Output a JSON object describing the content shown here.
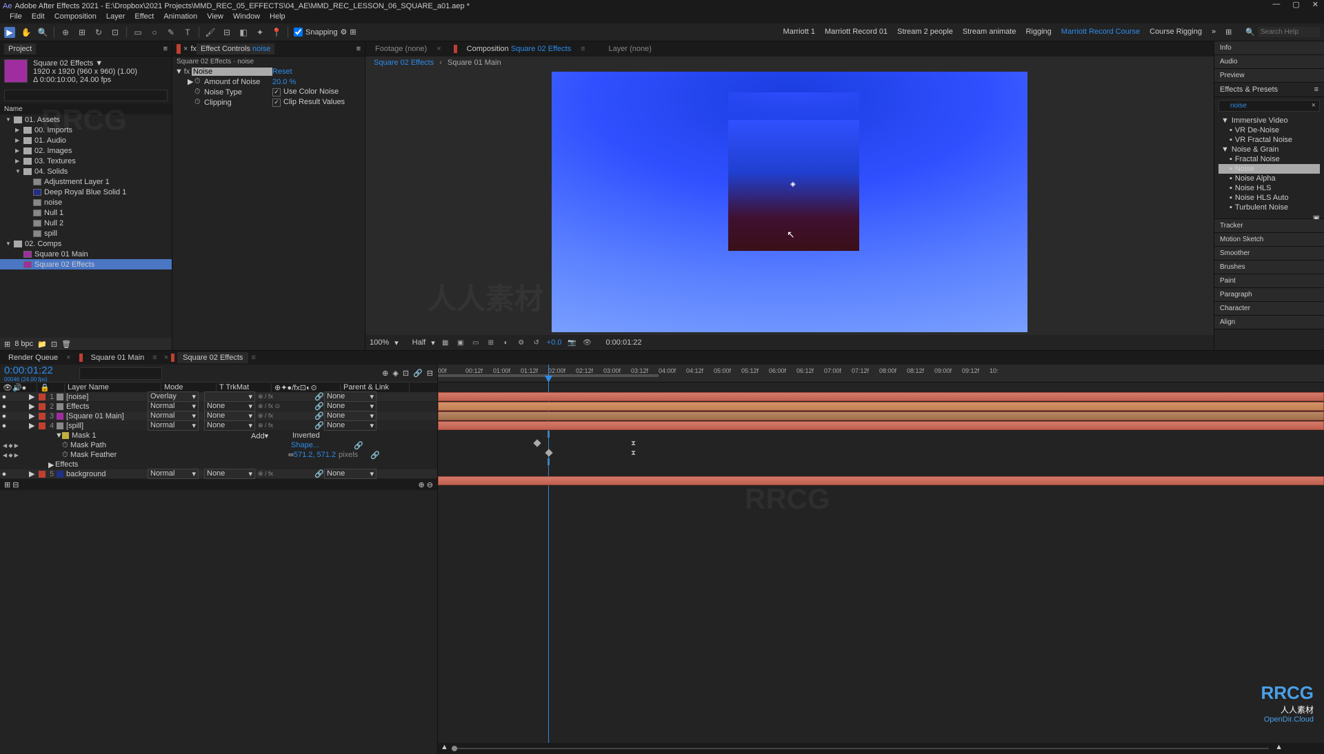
{
  "window": {
    "title": "Adobe After Effects 2021 - E:\\Dropbox\\2021 Projects\\MMD_REC_05_EFFECTS\\04_AE\\MMD_REC_LESSON_06_SQUARE_a01.aep *"
  },
  "menu": [
    "File",
    "Edit",
    "Composition",
    "Layer",
    "Effect",
    "Animation",
    "View",
    "Window",
    "Help"
  ],
  "toolbar": {
    "snapping": "Snapping",
    "workspaces": [
      "Marriott 1",
      "Marriott Record 01",
      "Stream 2 people",
      "Stream animate",
      "Rigging",
      "Marriott Record Course",
      "Course Rigging"
    ],
    "active_workspace": 5,
    "search_placeholder": "Search Help"
  },
  "project": {
    "tab": "Project",
    "sel_name": "Square 02 Effects ▼",
    "sel_dims": "1920 x 1920 (960 x 960) (1.00)",
    "sel_dur": "Δ 0:00:10:00, 24.00 fps",
    "name_hdr": "Name",
    "bpc": "8 bpc",
    "items": [
      {
        "indent": 0,
        "caret": "▼",
        "type": "folder",
        "label": "01. Assets"
      },
      {
        "indent": 1,
        "caret": "▶",
        "type": "folder",
        "label": "00. Imports"
      },
      {
        "indent": 1,
        "caret": "▶",
        "type": "folder",
        "label": "01. Audio"
      },
      {
        "indent": 1,
        "caret": "▶",
        "type": "folder",
        "label": "02. Images"
      },
      {
        "indent": 1,
        "caret": "▶",
        "type": "folder",
        "label": "03. Textures"
      },
      {
        "indent": 1,
        "caret": "▼",
        "type": "folder",
        "label": "04. Solids"
      },
      {
        "indent": 2,
        "type": "solid",
        "color": "#888",
        "label": "Adjustment Layer 1"
      },
      {
        "indent": 2,
        "type": "solid",
        "color": "#203088",
        "label": "Deep Royal Blue Solid 1"
      },
      {
        "indent": 2,
        "type": "solid",
        "color": "#888",
        "label": "noise"
      },
      {
        "indent": 2,
        "type": "solid",
        "color": "#888",
        "label": "Null 1"
      },
      {
        "indent": 2,
        "type": "solid",
        "color": "#888",
        "label": "Null 2"
      },
      {
        "indent": 2,
        "type": "solid",
        "color": "#888",
        "label": "spill"
      },
      {
        "indent": 0,
        "caret": "▼",
        "type": "folder",
        "label": "02. Comps"
      },
      {
        "indent": 1,
        "type": "comp",
        "label": "Square 01 Main"
      },
      {
        "indent": 1,
        "type": "comp",
        "label": "Square 02 Effects",
        "sel": true
      }
    ]
  },
  "effect_controls": {
    "tab": "Effect Controls",
    "layer": "noise",
    "breadcrumb": "Square 02 Effects · noise",
    "effect_name": "Noise",
    "reset": "Reset",
    "props": [
      {
        "stopwatch": true,
        "label": "Amount of Noise",
        "value": "20.0 %"
      },
      {
        "stopwatch": true,
        "label": "Noise Type",
        "checkbox": true,
        "cblabel": "Use Color Noise"
      },
      {
        "stopwatch": true,
        "label": "Clipping",
        "checkbox": true,
        "cblabel": "Clip Result Values"
      }
    ]
  },
  "viewer": {
    "footage_tab": "Footage (none)",
    "comp_tab_prefix": "Composition",
    "comp_tab_name": "Square 02 Effects",
    "layer_tab": "Layer (none)",
    "comp_chain": [
      "Square 02 Effects",
      "Square 01 Main"
    ],
    "zoom": "100%",
    "res": "Half",
    "expo": "+0.0",
    "time": "0:00:01:22"
  },
  "right": {
    "sections": [
      "Info",
      "Audio",
      "Preview",
      "Effects & Presets",
      "Tracker",
      "Motion Sketch",
      "Smoother",
      "Brushes",
      "Paint",
      "Paragraph",
      "Character",
      "Align"
    ],
    "preset_search": "noise",
    "preset_tree": [
      {
        "indent": 0,
        "caret": "▼",
        "label": "Immersive Video"
      },
      {
        "indent": 1,
        "label": "VR De-Noise"
      },
      {
        "indent": 1,
        "label": "VR Fractal Noise"
      },
      {
        "indent": 0,
        "caret": "▼",
        "label": "Noise & Grain"
      },
      {
        "indent": 1,
        "label": "Fractal Noise"
      },
      {
        "indent": 1,
        "label": "Noise",
        "sel": true
      },
      {
        "indent": 1,
        "label": "Noise Alpha"
      },
      {
        "indent": 1,
        "label": "Noise HLS"
      },
      {
        "indent": 1,
        "label": "Noise HLS Auto"
      },
      {
        "indent": 1,
        "label": "Turbulent Noise"
      }
    ]
  },
  "timeline": {
    "tabs": [
      "Render Queue",
      "Square 01 Main",
      "Square 02 Effects"
    ],
    "active_tab": 2,
    "timecode": "0:00:01:22",
    "timecode_sub": "00046 (24.00 fps)",
    "hdr": {
      "layer": "Layer Name",
      "mode": "Mode",
      "trkmat": "T  TrkMat",
      "parent": "Parent & Link"
    },
    "layers": [
      {
        "eye": "●",
        "num": "1",
        "color": "#c04030",
        "name": "[noise]",
        "mode": "Overlay",
        "trk": "",
        "parent": "None"
      },
      {
        "eye": "●",
        "num": "2",
        "color": "#c04030",
        "name": "Effects",
        "mode": "Normal",
        "trk": "None",
        "parent": "None",
        "fx": true
      },
      {
        "eye": "●",
        "num": "3",
        "color": "#c04030",
        "name": "[Square 01 Main]",
        "mode": "Normal",
        "trk": "None",
        "parent": "None",
        "comp": true
      },
      {
        "eye": "●",
        "num": "4",
        "color": "#c04030",
        "name": "[spill]",
        "mode": "Normal",
        "trk": "None",
        "parent": "None"
      }
    ],
    "mask": {
      "name": "Mask 1",
      "mode": "Add",
      "inverted": "Inverted",
      "path_label": "Mask Path",
      "path_val": "Shape...",
      "feather_label": "Mask Feather",
      "feather_val": "571.2, 571.2",
      "feather_unit": "pixels",
      "effects_label": "Effects"
    },
    "bg_layer": {
      "num": "5",
      "color": "#c04030",
      "name": "background",
      "mode": "Normal",
      "trk": "None",
      "parent": "None"
    },
    "ticks": [
      "00f",
      "00:12f",
      "01:00f",
      "01:12f",
      "02:00f",
      "02:12f",
      "03:00f",
      "03:12f",
      "04:00f",
      "04:12f",
      "05:00f",
      "05:12f",
      "06:00f",
      "06:12f",
      "07:00f",
      "07:12f",
      "08:00f",
      "08:12f",
      "09:00f",
      "09:12f",
      "10:"
    ]
  }
}
